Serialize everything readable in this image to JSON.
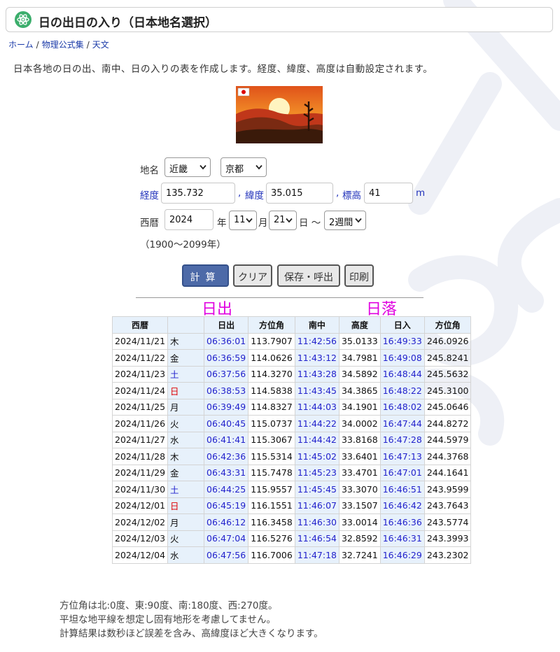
{
  "header": {
    "title": "日の出日の入り（日本地名選択）"
  },
  "breadcrumb": [
    {
      "label": "ホーム"
    },
    {
      "label": "物理公式集"
    },
    {
      "label": "天文"
    }
  ],
  "description": "日本各地の日の出、南中、日の入りの表を作成します。経度、緯度、高度は自動設定されます。",
  "form": {
    "place_label": "地名",
    "region": "近畿",
    "city": "京都",
    "longitude_label": "経度",
    "longitude": "135.732",
    "comma": ",",
    "latitude_label": "緯度",
    "latitude": "35.015",
    "altitude_label": "標高",
    "altitude": "41",
    "altitude_unit": "m",
    "era_label": "西暦",
    "year": "2024",
    "year_unit": "年",
    "month": "11",
    "month_unit": "月",
    "day": "21",
    "day_unit": "日 〜",
    "period": "2週間",
    "range_note": "（1900〜2099年）"
  },
  "buttons": {
    "calculate": "計算",
    "clear": "クリア",
    "save_load": "保存・呼出",
    "print": "印刷"
  },
  "section_labels": {
    "sunrise": "日出",
    "sunset": "日落"
  },
  "table": {
    "headers": [
      "西暦",
      "",
      "日出",
      "方位角",
      "南中",
      "高度",
      "日入",
      "方位角"
    ],
    "rows": [
      {
        "date": "2024/11/21",
        "wd": "木",
        "type": "",
        "rise": "06:36:01",
        "raz": "113.7907",
        "noon": "11:42:56",
        "alt": "35.0133",
        "set": "16:49:33",
        "saz": "246.0926"
      },
      {
        "date": "2024/11/22",
        "wd": "金",
        "type": "",
        "rise": "06:36:59",
        "raz": "114.0626",
        "noon": "11:43:12",
        "alt": "34.7981",
        "set": "16:49:08",
        "saz": "245.8241"
      },
      {
        "date": "2024/11/23",
        "wd": "土",
        "type": "sat",
        "rise": "06:37:56",
        "raz": "114.3270",
        "noon": "11:43:28",
        "alt": "34.5892",
        "set": "16:48:44",
        "saz": "245.5632"
      },
      {
        "date": "2024/11/24",
        "wd": "日",
        "type": "sun",
        "rise": "06:38:53",
        "raz": "114.5838",
        "noon": "11:43:45",
        "alt": "34.3865",
        "set": "16:48:22",
        "saz": "245.3100"
      },
      {
        "date": "2024/11/25",
        "wd": "月",
        "type": "",
        "rise": "06:39:49",
        "raz": "114.8327",
        "noon": "11:44:03",
        "alt": "34.1901",
        "set": "16:48:02",
        "saz": "245.0646"
      },
      {
        "date": "2024/11/26",
        "wd": "火",
        "type": "",
        "rise": "06:40:45",
        "raz": "115.0737",
        "noon": "11:44:22",
        "alt": "34.0002",
        "set": "16:47:44",
        "saz": "244.8272"
      },
      {
        "date": "2024/11/27",
        "wd": "水",
        "type": "",
        "rise": "06:41:41",
        "raz": "115.3067",
        "noon": "11:44:42",
        "alt": "33.8168",
        "set": "16:47:28",
        "saz": "244.5979"
      },
      {
        "date": "2024/11/28",
        "wd": "木",
        "type": "",
        "rise": "06:42:36",
        "raz": "115.5314",
        "noon": "11:45:02",
        "alt": "33.6401",
        "set": "16:47:13",
        "saz": "244.3768"
      },
      {
        "date": "2024/11/29",
        "wd": "金",
        "type": "",
        "rise": "06:43:31",
        "raz": "115.7478",
        "noon": "11:45:23",
        "alt": "33.4701",
        "set": "16:47:01",
        "saz": "244.1641"
      },
      {
        "date": "2024/11/30",
        "wd": "土",
        "type": "sat",
        "rise": "06:44:25",
        "raz": "115.9557",
        "noon": "11:45:45",
        "alt": "33.3070",
        "set": "16:46:51",
        "saz": "243.9599"
      },
      {
        "date": "2024/12/01",
        "wd": "日",
        "type": "sun",
        "rise": "06:45:19",
        "raz": "116.1551",
        "noon": "11:46:07",
        "alt": "33.1507",
        "set": "16:46:42",
        "saz": "243.7643"
      },
      {
        "date": "2024/12/02",
        "wd": "月",
        "type": "",
        "rise": "06:46:12",
        "raz": "116.3458",
        "noon": "11:46:30",
        "alt": "33.0014",
        "set": "16:46:36",
        "saz": "243.5774"
      },
      {
        "date": "2024/12/03",
        "wd": "火",
        "type": "",
        "rise": "06:47:04",
        "raz": "116.5276",
        "noon": "11:46:54",
        "alt": "32.8592",
        "set": "16:46:31",
        "saz": "243.3993"
      },
      {
        "date": "2024/12/04",
        "wd": "水",
        "type": "",
        "rise": "06:47:56",
        "raz": "116.7006",
        "noon": "11:47:18",
        "alt": "32.7241",
        "set": "16:46:29",
        "saz": "243.2302"
      }
    ]
  },
  "notes": [
    "方位角は北:0度、東:90度、南:180度、西:270度。",
    "平坦な地平線を想定し固有地形を考慮してません。",
    "計算結果は数秒ほど誤差を含み、高緯度ほど大きくなります。"
  ],
  "colors": {
    "accent": "#4d6aa8",
    "link": "#1a3aa8",
    "section_label": "#e000e0",
    "table_header_bg": "#e7f1fb",
    "time_text": "#2222cc",
    "sunday": "#dd0000",
    "saturday": "#2222cc"
  },
  "icons": {
    "logo": "atom-logo-icon",
    "dropdown": "chevron-down-icon",
    "flag": "japan-flag-icon"
  }
}
